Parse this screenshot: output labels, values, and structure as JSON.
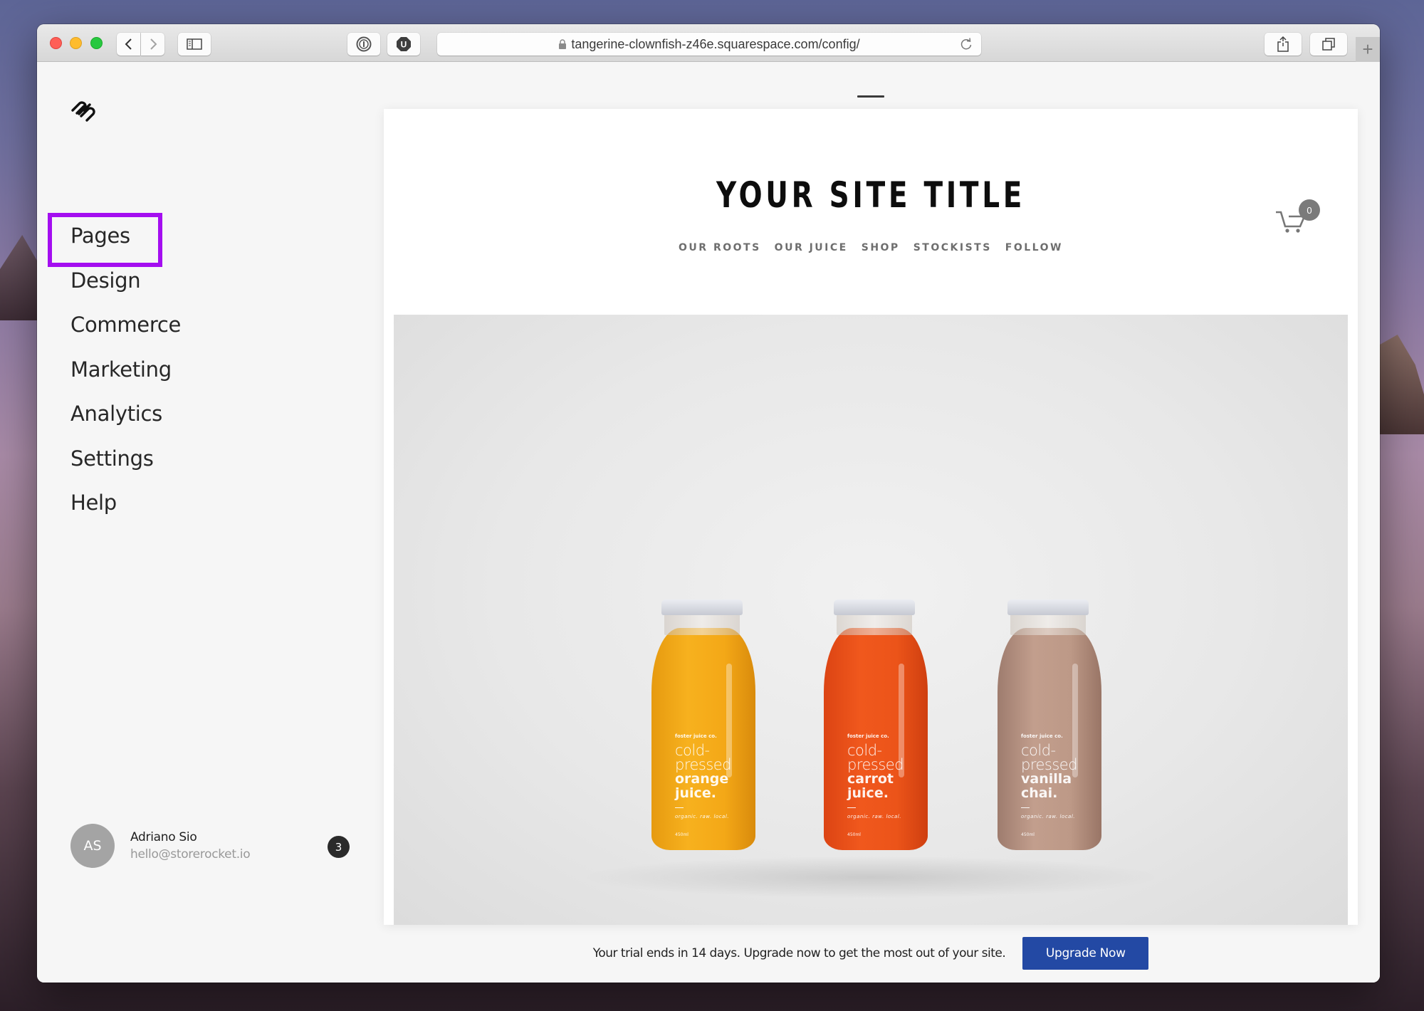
{
  "browser": {
    "url": "tangerine-clownfish-z46e.squarespace.com/config/",
    "buttons": {
      "back": "back-icon",
      "forward": "forward-icon",
      "sidebar": "sidebar-icon",
      "extension1": "1password-icon",
      "extension2": "ublock-icon",
      "share": "share-icon",
      "tabs": "tabs-overview-icon",
      "new_tab": "+"
    }
  },
  "sidebar": {
    "logo": "squarespace-logo-icon",
    "items": [
      {
        "label": "Pages",
        "highlighted": true
      },
      {
        "label": "Design"
      },
      {
        "label": "Commerce"
      },
      {
        "label": "Marketing"
      },
      {
        "label": "Analytics"
      },
      {
        "label": "Settings"
      },
      {
        "label": "Help"
      }
    ],
    "highlight_color": "#a40ef0",
    "user": {
      "initials": "AS",
      "name": "Adriano Sio",
      "email": "hello@storerocket.io",
      "notifications": "3"
    }
  },
  "preview": {
    "site_title": "YOUR SITE TITLE",
    "nav": [
      "OUR ROOTS",
      "OUR JUICE",
      "SHOP",
      "STOCKISTS",
      "FOLLOW"
    ],
    "cart_count": "0",
    "bottles": [
      {
        "brand": "foster juice co.",
        "line1a": "cold-",
        "line1b": "pressed",
        "line2a": "orange",
        "line2b": "juice.",
        "tagline": "organic. raw. local.",
        "volume": "450ml"
      },
      {
        "brand": "foster juice co.",
        "line1a": "cold-",
        "line1b": "pressed",
        "line2a": "carrot",
        "line2b": "juice.",
        "tagline": "organic. raw. local.",
        "volume": "450ml"
      },
      {
        "brand": "foster juice co.",
        "line1a": "cold-",
        "line1b": "pressed",
        "line2a": "vanilla",
        "line2b": "chai.",
        "tagline": "organic. raw. local.",
        "volume": "450ml"
      }
    ]
  },
  "trial": {
    "message": "Your trial ends in 14 days. Upgrade now to get the most out of your site.",
    "button": "Upgrade Now",
    "button_color": "#2349a4"
  }
}
